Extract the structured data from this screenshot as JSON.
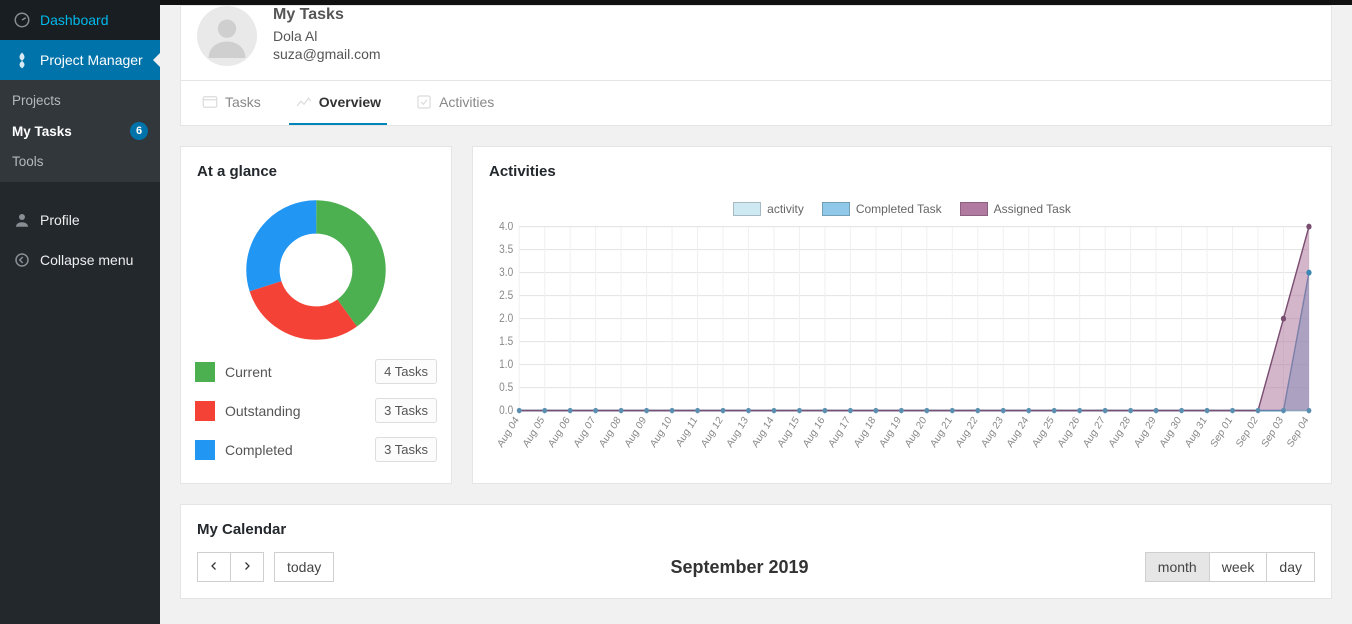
{
  "sidebar": {
    "dashboard": "Dashboard",
    "project_manager": "Project Manager",
    "submenu": {
      "projects": "Projects",
      "my_tasks": "My Tasks",
      "my_tasks_badge": "6",
      "tools": "Tools"
    },
    "profile": "Profile",
    "collapse": "Collapse menu"
  },
  "header": {
    "title": "My Tasks",
    "name": "Dola Al",
    "email": "suza@gmail.com"
  },
  "tabs": {
    "tasks": "Tasks",
    "overview": "Overview",
    "activities": "Activities"
  },
  "glance": {
    "title": "At a glance",
    "items": [
      {
        "label": "Current",
        "count": "4 Tasks",
        "value": 4
      },
      {
        "label": "Outstanding",
        "count": "3 Tasks",
        "value": 3
      },
      {
        "label": "Completed",
        "count": "3 Tasks",
        "value": 3
      }
    ]
  },
  "activities": {
    "title": "Activities",
    "legend": {
      "activity": "activity",
      "completed": "Completed Task",
      "assigned": "Assigned Task"
    }
  },
  "chart_data": {
    "type": "area",
    "title": "Activities",
    "ylabel": "",
    "xlabel": "",
    "ylim": [
      0,
      4
    ],
    "yticks": [
      0,
      0.5,
      1.0,
      1.5,
      2.0,
      2.5,
      3.0,
      3.5,
      4.0
    ],
    "categories": [
      "Aug 04",
      "Aug 05",
      "Aug 06",
      "Aug 07",
      "Aug 08",
      "Aug 09",
      "Aug 10",
      "Aug 11",
      "Aug 12",
      "Aug 13",
      "Aug 14",
      "Aug 15",
      "Aug 16",
      "Aug 17",
      "Aug 18",
      "Aug 19",
      "Aug 20",
      "Aug 21",
      "Aug 22",
      "Aug 23",
      "Aug 24",
      "Aug 25",
      "Aug 26",
      "Aug 27",
      "Aug 28",
      "Aug 29",
      "Aug 30",
      "Aug 31",
      "Sep 01",
      "Sep 02",
      "Sep 03",
      "Sep 04"
    ],
    "series": [
      {
        "name": "activity",
        "values": [
          0,
          0,
          0,
          0,
          0,
          0,
          0,
          0,
          0,
          0,
          0,
          0,
          0,
          0,
          0,
          0,
          0,
          0,
          0,
          0,
          0,
          0,
          0,
          0,
          0,
          0,
          0,
          0,
          0,
          0,
          0,
          0
        ]
      },
      {
        "name": "Completed Task",
        "values": [
          0,
          0,
          0,
          0,
          0,
          0,
          0,
          0,
          0,
          0,
          0,
          0,
          0,
          0,
          0,
          0,
          0,
          0,
          0,
          0,
          0,
          0,
          0,
          0,
          0,
          0,
          0,
          0,
          0,
          0,
          0,
          3
        ]
      },
      {
        "name": "Assigned Task",
        "values": [
          0,
          0,
          0,
          0,
          0,
          0,
          0,
          0,
          0,
          0,
          0,
          0,
          0,
          0,
          0,
          0,
          0,
          0,
          0,
          0,
          0,
          0,
          0,
          0,
          0,
          0,
          0,
          0,
          0,
          0,
          2,
          4
        ]
      }
    ]
  },
  "calendar": {
    "title": "My Calendar",
    "month_label": "September 2019",
    "today": "today",
    "views": {
      "month": "month",
      "week": "week",
      "day": "day"
    }
  }
}
